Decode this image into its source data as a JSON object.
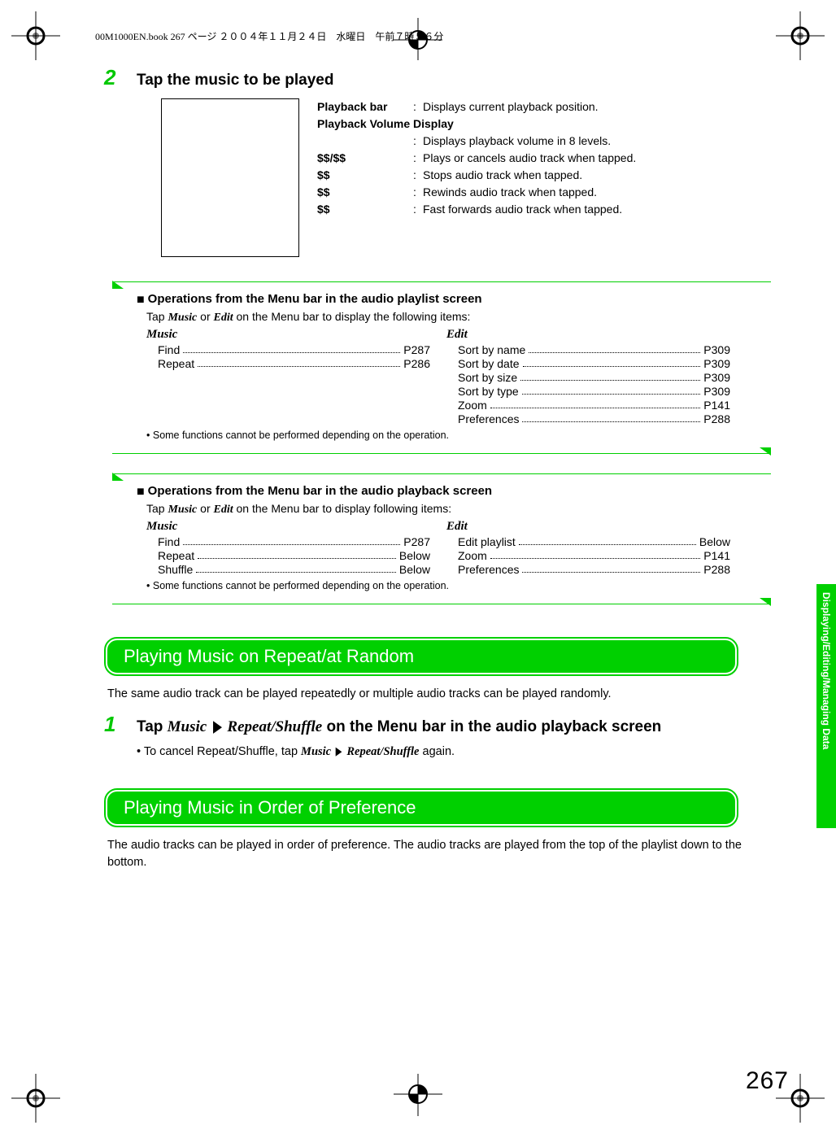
{
  "header_line": "00M1000EN.book  267 ページ  ２００４年１１月２４日　水曜日　午前７時５６分",
  "step2": {
    "num": "2",
    "title": "Tap the music to be played"
  },
  "defs": {
    "playback_bar_label": "Playback bar",
    "playback_bar_desc": "Displays current playback position.",
    "playback_vol_label": "Playback Volume Display",
    "playback_vol_desc": "Displays playback volume in 8 levels.",
    "playpause_label": "$$/$$",
    "playpause_desc": "Plays or cancels audio track when tapped.",
    "stop_label": "$$",
    "stop_desc": "Stops audio track when tapped.",
    "rewind_label": "$$",
    "rewind_desc": "Rewinds audio track when tapped.",
    "ff_label": "$$",
    "ff_desc": "Fast forwards audio track when tapped."
  },
  "note1": {
    "title": "Operations from the Menu bar in the audio playlist screen",
    "intro_pre": "Tap ",
    "intro_m1": "Music",
    "intro_or": " or ",
    "intro_m2": "Edit",
    "intro_post": " on the Menu bar to display the following items:",
    "music_heading": "Music",
    "edit_heading": "Edit",
    "music_items": [
      {
        "label": "Find",
        "page": "P287"
      },
      {
        "label": "Repeat",
        "page": "P286"
      }
    ],
    "edit_items": [
      {
        "label": "Sort by name",
        "page": "P309"
      },
      {
        "label": "Sort by date",
        "page": "P309"
      },
      {
        "label": "Sort by size",
        "page": "P309"
      },
      {
        "label": "Sort by type",
        "page": "P309"
      },
      {
        "label": "Zoom",
        "page": "P141"
      },
      {
        "label": "Preferences",
        "page": "P288"
      }
    ],
    "footnote": "Some functions cannot be performed depending on the operation."
  },
  "note2": {
    "title": "Operations from the Menu bar in the audio playback screen",
    "intro_pre": "Tap ",
    "intro_m1": "Music",
    "intro_or": " or ",
    "intro_m2": "Edit",
    "intro_post": " on the Menu bar to display following items:",
    "music_heading": "Music",
    "edit_heading": "Edit",
    "music_items": [
      {
        "label": "Find",
        "page": "P287"
      },
      {
        "label": "Repeat",
        "page": "Below"
      },
      {
        "label": "Shuffle",
        "page": "Below"
      }
    ],
    "edit_items": [
      {
        "label": "Edit playlist",
        "page": "Below"
      },
      {
        "label": "Zoom",
        "page": "P141"
      },
      {
        "label": "Preferences",
        "page": "P288"
      }
    ],
    "footnote": "Some functions cannot be performed depending on the operation."
  },
  "section1": {
    "heading": "Playing Music on Repeat/at Random",
    "body": "The same audio track can be played repeatedly or multiple audio tracks can be played randomly.",
    "step_num": "1",
    "step_pre": "Tap ",
    "step_m1": "Music",
    "step_arrow": "▶",
    "step_m2": "Repeat/Shuffle",
    "step_post": " on the Menu bar in the audio playback screen",
    "bullet_pre": "To cancel Repeat/Shuffle, tap ",
    "bullet_m1": "Music",
    "bullet_arrow": "▶",
    "bullet_m2": "Repeat/Shuffle",
    "bullet_post": " again."
  },
  "section2": {
    "heading": "Playing Music in Order of Preference",
    "body": "The audio tracks can be played in order of preference. The audio tracks are played from the top of the playlist down to the bottom."
  },
  "side_tab": "Displaying/Editing/Managing Data",
  "page_number": "267"
}
